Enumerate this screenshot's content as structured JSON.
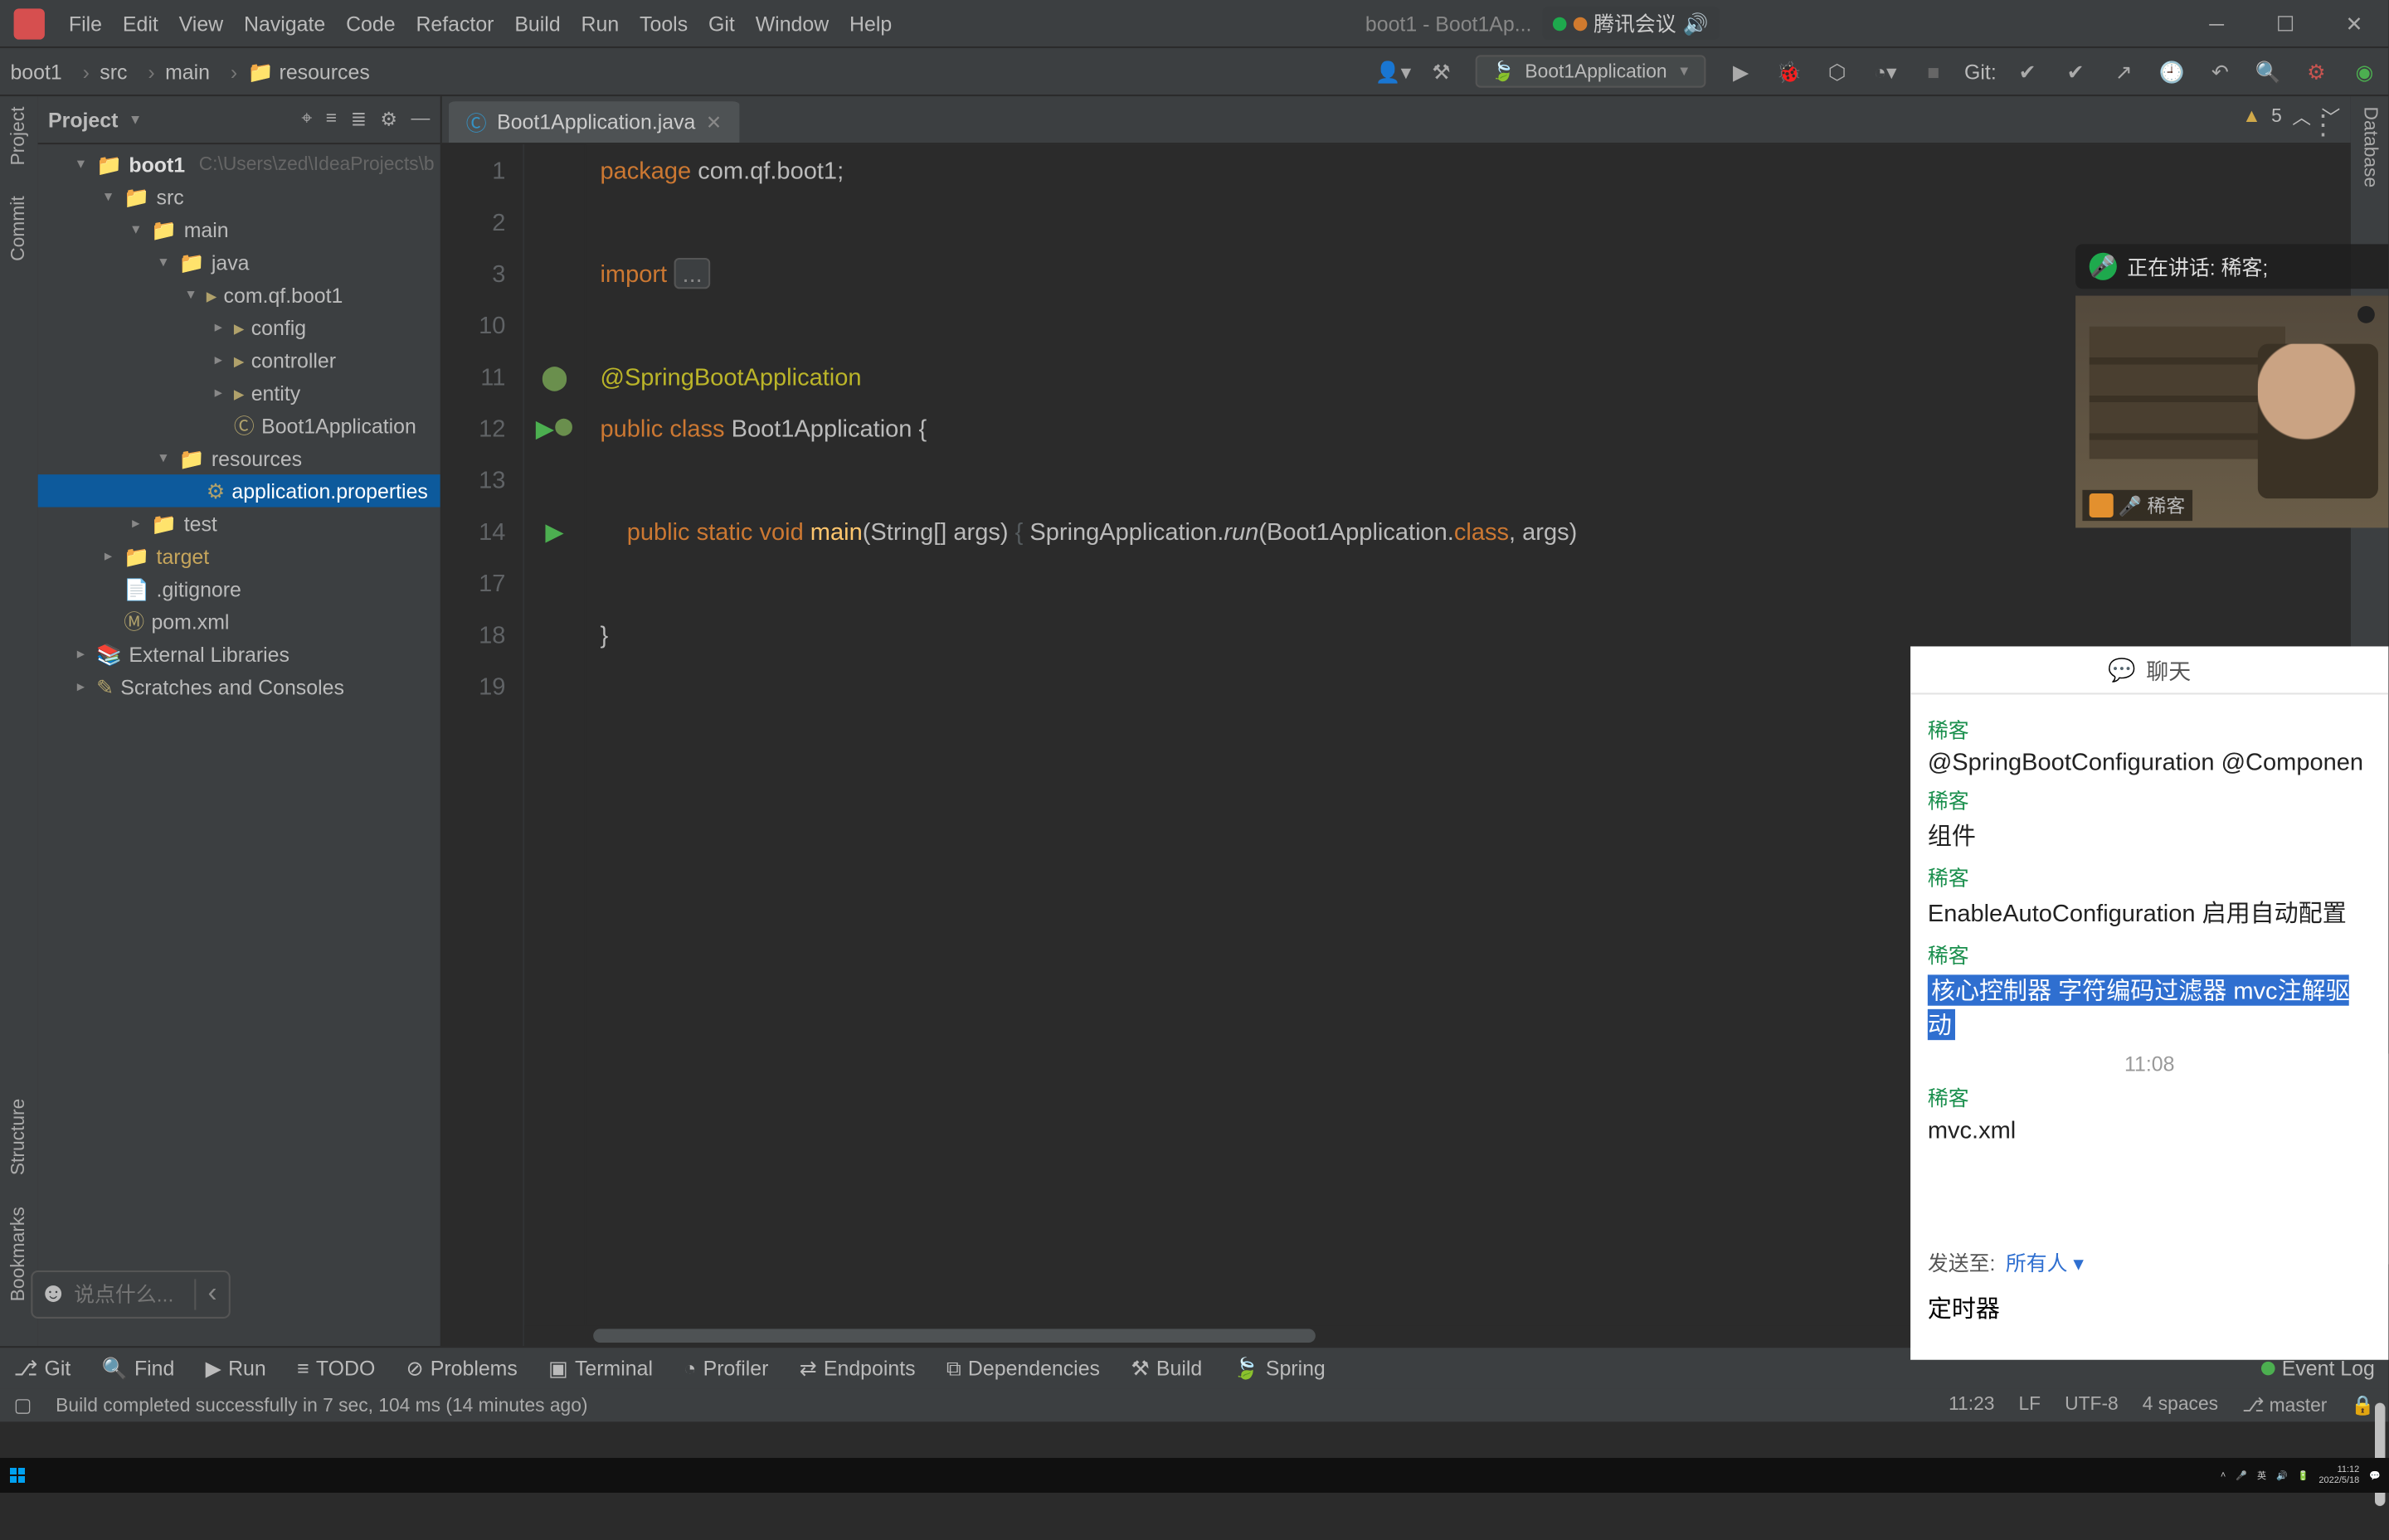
{
  "window_title_left": "boot1 - Boot1Ap...",
  "tencent_label": "腾讯会议",
  "menu": [
    "File",
    "Edit",
    "View",
    "Navigate",
    "Code",
    "Refactor",
    "Build",
    "Run",
    "Tools",
    "Git",
    "Window",
    "Help"
  ],
  "breadcrumb": [
    "boot1",
    "src",
    "main",
    "resources"
  ],
  "run_config": "Boot1Application",
  "git_label": "Git:",
  "project_panel_title": "Project",
  "tree": {
    "root": "boot1",
    "root_path": "C:\\Users\\zed\\IdeaProjects\\b",
    "items": [
      {
        "depth": 0,
        "arrow": "▾",
        "icon": "folder",
        "name": "boot1",
        "bold": true,
        "hint": "C:\\Users\\zed\\IdeaProjects\\b"
      },
      {
        "depth": 1,
        "arrow": "▾",
        "icon": "folder",
        "name": "src"
      },
      {
        "depth": 2,
        "arrow": "▾",
        "icon": "folder",
        "name": "main"
      },
      {
        "depth": 3,
        "arrow": "▾",
        "icon": "folder",
        "name": "java"
      },
      {
        "depth": 4,
        "arrow": "▾",
        "icon": "pkg",
        "name": "com.qf.boot1"
      },
      {
        "depth": 5,
        "arrow": "▸",
        "icon": "pkg",
        "name": "config"
      },
      {
        "depth": 5,
        "arrow": "▸",
        "icon": "pkg",
        "name": "controller"
      },
      {
        "depth": 5,
        "arrow": "▸",
        "icon": "pkg",
        "name": "entity"
      },
      {
        "depth": 5,
        "arrow": " ",
        "icon": "class",
        "name": "Boot1Application"
      },
      {
        "depth": 3,
        "arrow": "▾",
        "icon": "res",
        "name": "resources"
      },
      {
        "depth": 4,
        "arrow": " ",
        "icon": "prop",
        "name": "application.properties",
        "sel": true
      },
      {
        "depth": 2,
        "arrow": "▸",
        "icon": "folder",
        "name": "test"
      },
      {
        "depth": 1,
        "arrow": "▸",
        "icon": "target",
        "name": "target",
        "target": true
      },
      {
        "depth": 1,
        "arrow": " ",
        "icon": "file",
        "name": ".gitignore"
      },
      {
        "depth": 1,
        "arrow": " ",
        "icon": "maven",
        "name": "pom.xml"
      },
      {
        "depth": 0,
        "arrow": "▸",
        "icon": "lib",
        "name": "External Libraries"
      },
      {
        "depth": 0,
        "arrow": "▸",
        "icon": "scr",
        "name": "Scratches and Consoles"
      }
    ]
  },
  "left_tools": [
    "Project",
    "Commit"
  ],
  "left_tools_bottom": [
    "Structure",
    "Bookmarks"
  ],
  "right_tools": [
    "Database"
  ],
  "editor_tab": "Boot1Application.java",
  "editor_warn_count": "5",
  "editor_lines": [
    {
      "n": "1",
      "html": "<span class='kw'>package</span> com.qf.boot1;"
    },
    {
      "n": "2",
      "html": ""
    },
    {
      "n": "3",
      "html": "<span class='kw'>import</span> <span class='fold'>...</span>"
    },
    {
      "n": "10",
      "html": ""
    },
    {
      "n": "11",
      "html": "<span class='ann'>@SpringBootApplication</span>",
      "gut": "bean"
    },
    {
      "n": "12",
      "html": "<span class='kw'>public</span> <span class='kw'>class</span> Boot1Application {",
      "gut": "runclass"
    },
    {
      "n": "13",
      "html": ""
    },
    {
      "n": "14",
      "html": "    <span class='kw'>public</span> <span class='kw'>static</span> <span class='kw'>void</span> <span class='fn'>main</span>(String[] args) <span class='pale'>{</span> SpringApplication.<span class='it'>run</span>(Boot1Application.<span class='kw'>class</span>, args)",
      "gut": "run"
    },
    {
      "n": "17",
      "html": ""
    },
    {
      "n": "18",
      "html": "}"
    },
    {
      "n": "19",
      "html": ""
    }
  ],
  "speech_placeholder": "说点什么...",
  "bottom_tools": [
    "Git",
    "Find",
    "Run",
    "TODO",
    "Problems",
    "Terminal",
    "Profiler",
    "Endpoints",
    "Dependencies",
    "Build",
    "Spring"
  ],
  "event_log": "Event Log",
  "status_msg": "Build completed successfully in 7 sec, 104 ms (14 minutes ago)",
  "status_right": [
    "11:23",
    "LF",
    "UTF-8",
    "4 spaces",
    "master"
  ],
  "meeting": {
    "speaking": "正在讲话: 稀客;",
    "tag_name": "稀客"
  },
  "chat": {
    "title": "聊天",
    "items": [
      {
        "sender": "稀客",
        "msg": "@SpringBootConfiguration @Componen"
      },
      {
        "sender": "稀客",
        "msg": "组件"
      },
      {
        "sender": "稀客",
        "msg": "EnableAutoConfiguration 启用自动配置"
      },
      {
        "sender": "稀客",
        "msg": "核心控制器 字符编码过滤器 mvc注解驱动",
        "hl": true
      },
      {
        "time": "11:08"
      },
      {
        "sender": "稀客",
        "msg": "mvc.xml"
      }
    ],
    "send_to_label": "发送至:",
    "send_to_value": "所有人",
    "draft": "定时器"
  },
  "taskbar": {
    "ime": "英",
    "time": "11:12",
    "date": "2022/5/18"
  }
}
